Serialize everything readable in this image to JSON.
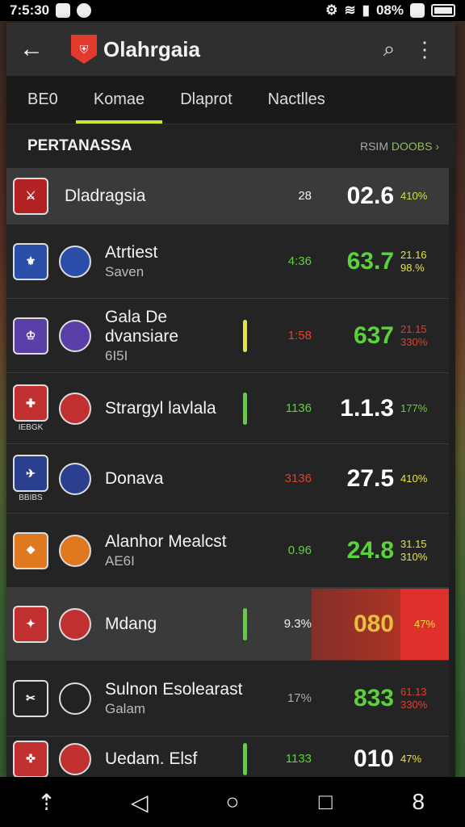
{
  "status_bar": {
    "time": "7:5:30",
    "battery_text": "08%"
  },
  "app_bar": {
    "title": "Olahrgaia"
  },
  "tabs": [
    {
      "label": "BE0",
      "active": false
    },
    {
      "label": "Komae",
      "active": true
    },
    {
      "label": "Dlaprot",
      "active": false
    },
    {
      "label": "Nactlles",
      "active": false
    }
  ],
  "section": {
    "title": "PERTANASSA",
    "link_prefix": "RSIM",
    "link_label": "DOOBS ›"
  },
  "colors": {
    "accent": "#c6e63a",
    "green": "#5ad33a",
    "red": "#e0402b",
    "yellow": "#e6e63a"
  },
  "rows": [
    {
      "crest_text": "⚔",
      "small_label": "",
      "name": "Dladragsia",
      "sub": "",
      "marker_color": "",
      "num1": "28",
      "num1_color": "#f2f2f2",
      "score": "02.6",
      "score_color": "#ffffff",
      "pct1": "410%",
      "pct2": "",
      "pct_color": "#c6e63a",
      "crest_color": "#b22222"
    },
    {
      "crest_text": "⚜",
      "small_label": "",
      "name": "Atrtiest",
      "sub": "Saven",
      "marker_color": "",
      "num1": "4:36",
      "num1_color": "#5ad33a",
      "score": "63.7",
      "score_color": "#5ad33a",
      "pct1": "21.16",
      "pct2": "98.%",
      "pct_color": "#e6e63a",
      "crest_color": "#2b4fa8"
    },
    {
      "crest_text": "♔",
      "small_label": "",
      "name": "Gala De dvansiare",
      "sub": "6I5I",
      "marker_color": "#e6e63a",
      "num1": "1:58",
      "num1_color": "#e0402b",
      "score": "637",
      "score_color": "#5ad33a",
      "pct1": "21.15",
      "pct2": "330%",
      "pct_color": "#e0402b",
      "crest_color": "#5a3fa8"
    },
    {
      "crest_text": "✚",
      "small_label": "IEBGK",
      "name": "Strargyl lavlala",
      "sub": "",
      "marker_color": "#5ad33a",
      "num1": "1136",
      "num1_color": "#5ad33a",
      "score": "1.1.3",
      "score_color": "#ffffff",
      "pct1": "177%",
      "pct2": "",
      "pct_color": "#5ad33a",
      "crest_color": "#c03030"
    },
    {
      "crest_text": "✈",
      "small_label": "BBIBS",
      "name": "Donava",
      "sub": "",
      "marker_color": "",
      "num1": "3136",
      "num1_color": "#e0402b",
      "score": "27.5",
      "score_color": "#ffffff",
      "pct1": "410%",
      "pct2": "",
      "pct_color": "#e6e63a",
      "crest_color": "#2b3f8f"
    },
    {
      "crest_text": "❖",
      "small_label": "",
      "name": "Alanhor Mealcst",
      "sub": "AE6I",
      "marker_color": "",
      "num1": "0.96",
      "num1_color": "#5ad33a",
      "score": "24.8",
      "score_color": "#5ad33a",
      "pct1": "31.15",
      "pct2": "310%",
      "pct_color": "#e6e63a",
      "crest_color": "#e07820"
    },
    {
      "crest_text": "✦",
      "small_label": "",
      "name": "Mdang",
      "sub": "",
      "marker_color": "#5ad33a",
      "num1": "9.3%",
      "num1_color": "#f2f2f2",
      "score": "080",
      "score_color": "#e6c03a",
      "pct1": "47%",
      "pct2": "",
      "pct_color": "#e6e63a",
      "crest_color": "#c03030"
    },
    {
      "crest_text": "✂",
      "small_label": "",
      "name": "Sulnon Esolearast",
      "sub": "Galam",
      "marker_color": "",
      "num1": "17%",
      "num1_color": "#aaaaaa",
      "score": "833",
      "score_color": "#5ad33a",
      "pct1": "61.13",
      "pct2": "330%",
      "pct_color": "#e0402b",
      "crest_color": "#222222"
    },
    {
      "crest_text": "✜",
      "small_label": "",
      "name": "Uedam. Elsf",
      "sub": "",
      "marker_color": "#5ad33a",
      "num1": "1133",
      "num1_color": "#5ad33a",
      "score": "010",
      "score_color": "#ffffff",
      "pct1": "47%",
      "pct2": "",
      "pct_color": "#e6e63a",
      "crest_color": "#c03030"
    }
  ]
}
